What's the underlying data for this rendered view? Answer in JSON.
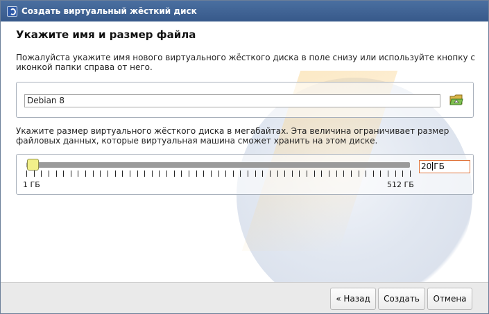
{
  "window": {
    "title": "Создать виртуальный жёсткий диск"
  },
  "page": {
    "heading": "Укажите имя и размер файла",
    "description_name": "Пожалуйста укажите имя нового виртуального жёсткого диска в поле снизу или используйте кнопку с иконкой папки справа от него.",
    "description_size": "Укажите размер виртуального жёсткого диска в мегабайтах. Эта величина ограничивает размер файловых данных, которые виртуальная машина сможет хранить на этом диске."
  },
  "name_field": {
    "value": "Debian 8",
    "folder_icon": "folder-open-icon"
  },
  "size": {
    "slider_value_gb": 20,
    "min_label": "1 ГБ",
    "max_label": "512 ГБ",
    "input_value_num": "20",
    "input_value_unit": "ГБ"
  },
  "buttons": {
    "back": "« Назад",
    "create": "Создать",
    "cancel": "Отмена"
  },
  "colors": {
    "titlebar": "#3f6496",
    "slider_knob": "#f2f08a",
    "size_input_border": "#e0743c"
  }
}
